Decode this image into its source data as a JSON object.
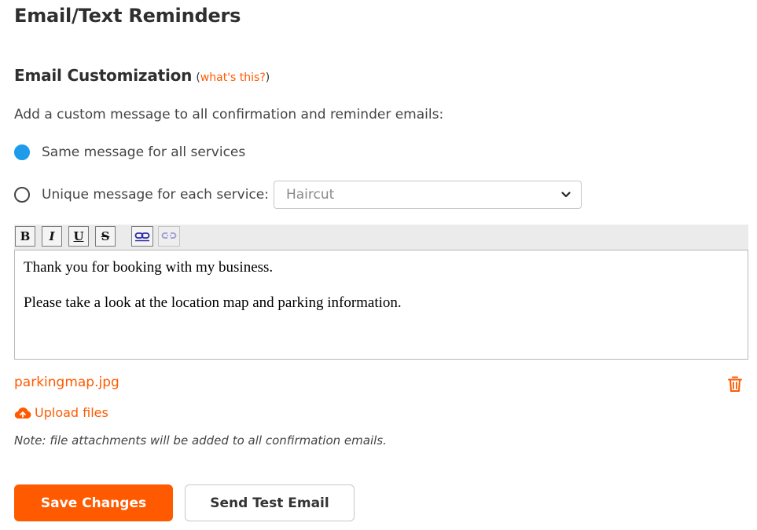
{
  "page": {
    "title": "Email/Text Reminders"
  },
  "section": {
    "title": "Email Customization",
    "paren_open": "(",
    "help_link": "what's this?",
    "paren_close": ")",
    "intro": "Add a custom message to all confirmation and reminder emails:"
  },
  "options": {
    "same_label": "Same message for all services",
    "same_checked": true,
    "unique_label": "Unique message for each service:",
    "unique_checked": false,
    "service_select": {
      "selected": "Haircut"
    }
  },
  "toolbar": {
    "bold": "B",
    "italic": "I",
    "underline": "U",
    "strike": "S",
    "link_icon": "link-icon",
    "unlink_icon": "unlink-icon"
  },
  "editor": {
    "paragraphs": [
      "Thank you for booking with my business.",
      "Please take a look at the location map and parking information."
    ]
  },
  "attachments": {
    "files": [
      {
        "name": "parkingmap.jpg",
        "icon": "trash-icon"
      }
    ],
    "upload_label": "Upload files",
    "upload_icon": "cloud-upload-icon",
    "note": "Note: file attachments will be added to all confirmation emails."
  },
  "actions": {
    "save_label": "Save Changes",
    "test_label": "Send Test Email"
  },
  "colors": {
    "accent": "#ff5a00",
    "radio_selected": "#1e9be9"
  }
}
